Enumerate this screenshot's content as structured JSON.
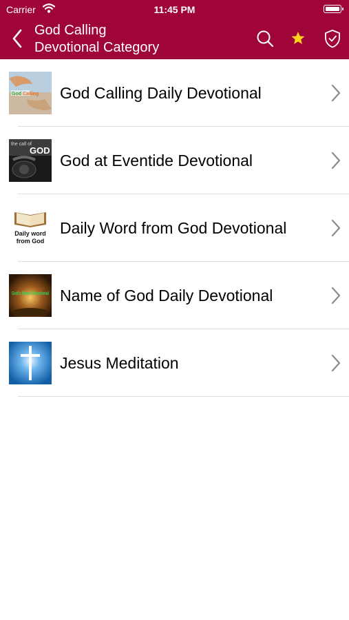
{
  "status_bar": {
    "carrier": "Carrier",
    "time": "11:45 PM"
  },
  "nav": {
    "title_line1": "God Calling",
    "title_line2": "Devotional Category"
  },
  "colors": {
    "header_bg": "#a0053a",
    "star": "#ffd21f",
    "divider": "#dedede",
    "chevron": "#8a8a8e"
  },
  "items": [
    {
      "label": "God Calling Daily Devotional",
      "icon": "hands-reaching-image"
    },
    {
      "label": "God at Eventide Devotional",
      "icon": "the-call-of-god-telephone-image"
    },
    {
      "label": "Daily Word from God Devotional",
      "icon": "open-bible-image",
      "thumb_text_1": "Daily word",
      "thumb_text_2": "from God"
    },
    {
      "label": "Name of God Daily Devotional",
      "icon": "gods-name-devotional-image",
      "thumb_text": "God's Name Devotional"
    },
    {
      "label": "Jesus Meditation",
      "icon": "glowing-cross-image"
    }
  ]
}
